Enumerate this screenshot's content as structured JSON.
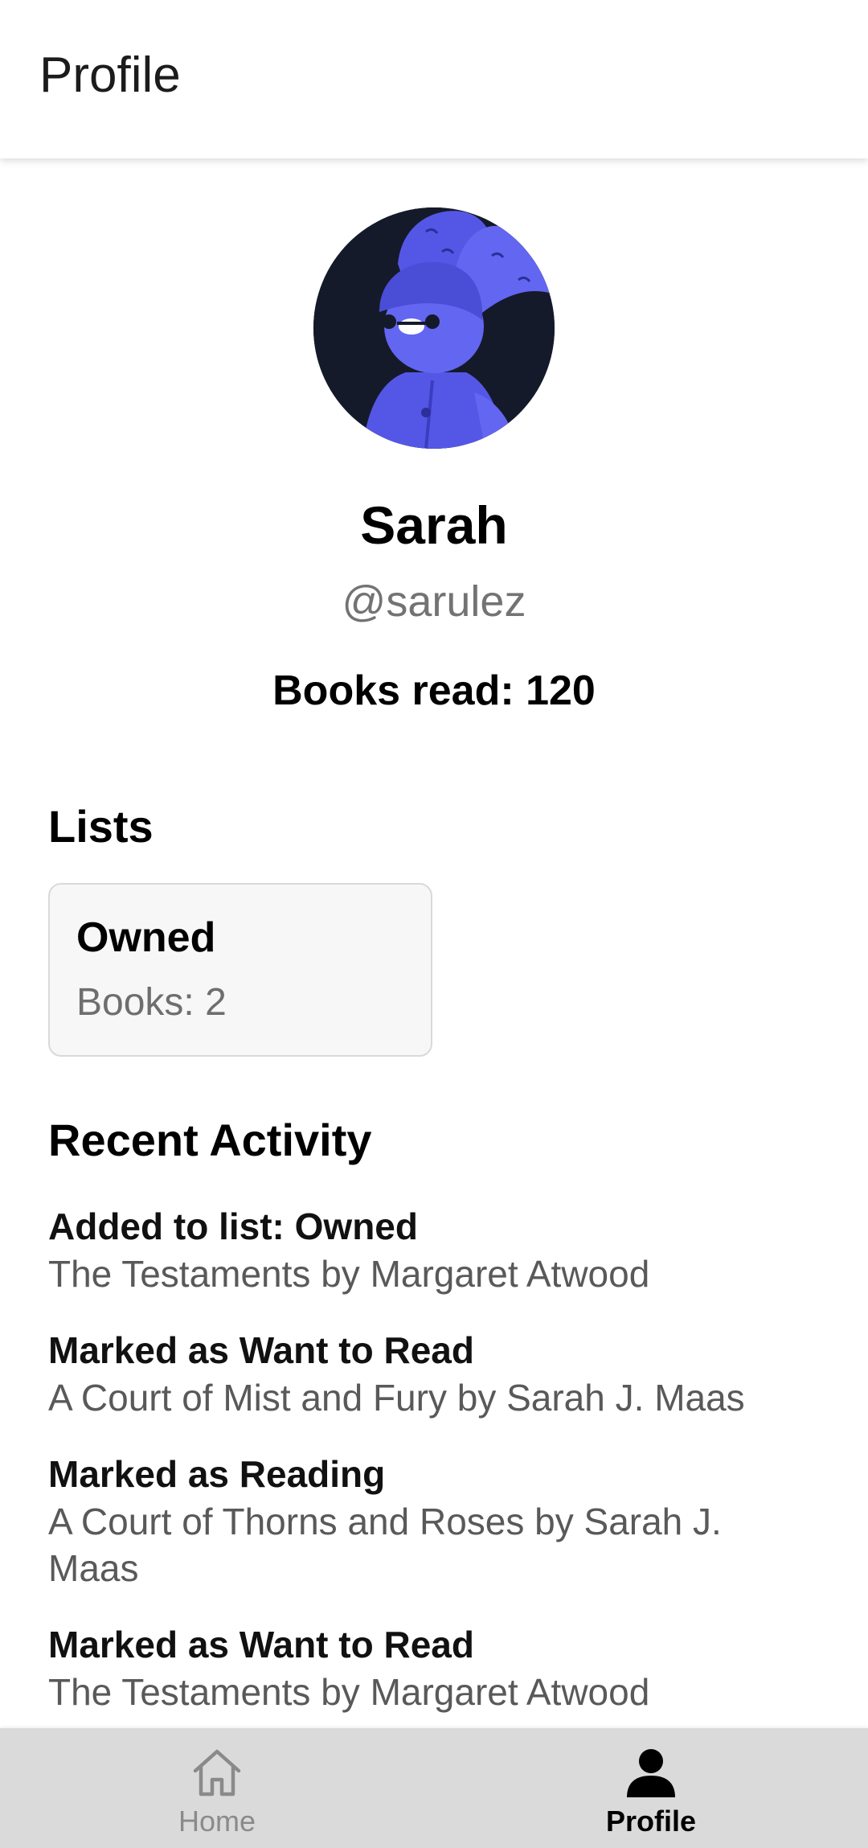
{
  "appbar": {
    "title": "Profile"
  },
  "profile": {
    "name": "Sarah",
    "handle": "@sarulez",
    "books_read": "Books read: 120"
  },
  "lists": {
    "heading": "Lists",
    "items": [
      {
        "title": "Owned",
        "count": "Books: 2"
      }
    ]
  },
  "activity": {
    "heading": "Recent Activity",
    "items": [
      {
        "action": "Added to list: Owned",
        "book": "The Testaments by Margaret Atwood"
      },
      {
        "action": "Marked as Want to Read",
        "book": "A Court of Mist and Fury by Sarah J. Maas"
      },
      {
        "action": "Marked as Reading",
        "book": "A Court of Thorns and Roses by Sarah J. Maas"
      },
      {
        "action": "Marked as Want to Read",
        "book": "The Testaments by Margaret Atwood"
      }
    ]
  },
  "bottom_nav": {
    "items": [
      {
        "label": "Home",
        "icon": "home-outline-icon",
        "active": false
      },
      {
        "label": "Profile",
        "icon": "person-filled-icon",
        "active": true
      }
    ]
  },
  "colors": {
    "avatar_background": "#151a2a",
    "avatar_accent": "#6366f1",
    "nav_background": "#dadada",
    "card_background": "#f7f7f7"
  }
}
